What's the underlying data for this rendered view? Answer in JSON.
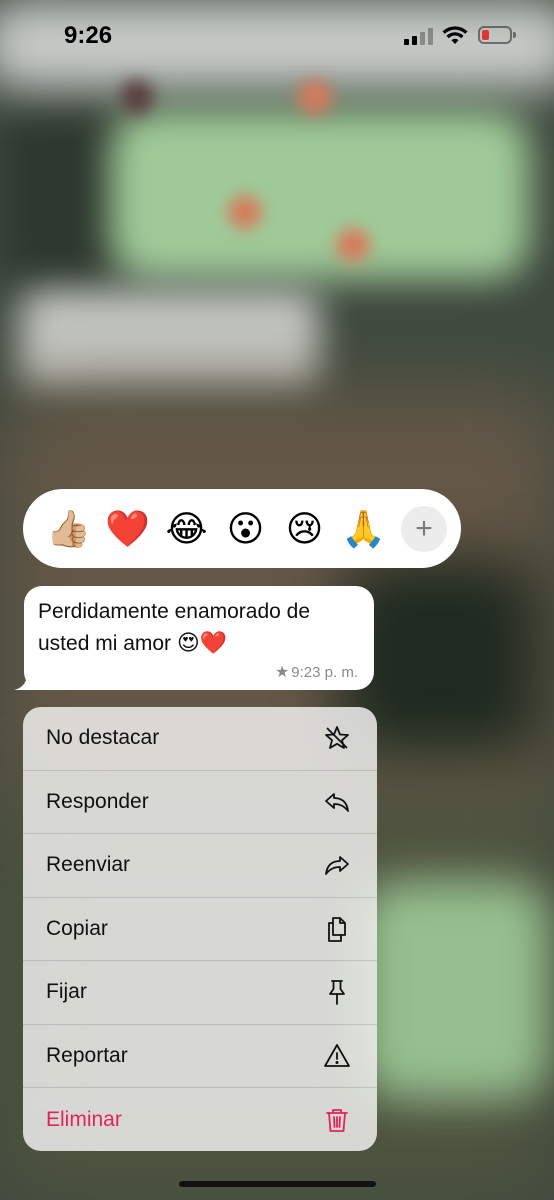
{
  "status_bar": {
    "time": "9:26"
  },
  "reactions": {
    "emojis": [
      "👍🏼",
      "❤️",
      "😂",
      "😮",
      "😢",
      "🙏"
    ],
    "more": "+"
  },
  "message": {
    "text": "Perdidamente enamorado de usted mi amor",
    "emojis": "😍❤️",
    "time": "9:23 p. m.",
    "starred": true
  },
  "menu": {
    "items": [
      {
        "label": "No destacar",
        "icon": "unstar-icon"
      },
      {
        "label": "Responder",
        "icon": "reply-icon"
      },
      {
        "label": "Reenviar",
        "icon": "forward-icon"
      },
      {
        "label": "Copiar",
        "icon": "copy-icon"
      },
      {
        "label": "Fijar",
        "icon": "pin-icon"
      },
      {
        "label": "Reportar",
        "icon": "warning-icon"
      },
      {
        "label": "Eliminar",
        "icon": "trash-icon",
        "color": "#e0245e"
      }
    ]
  }
}
